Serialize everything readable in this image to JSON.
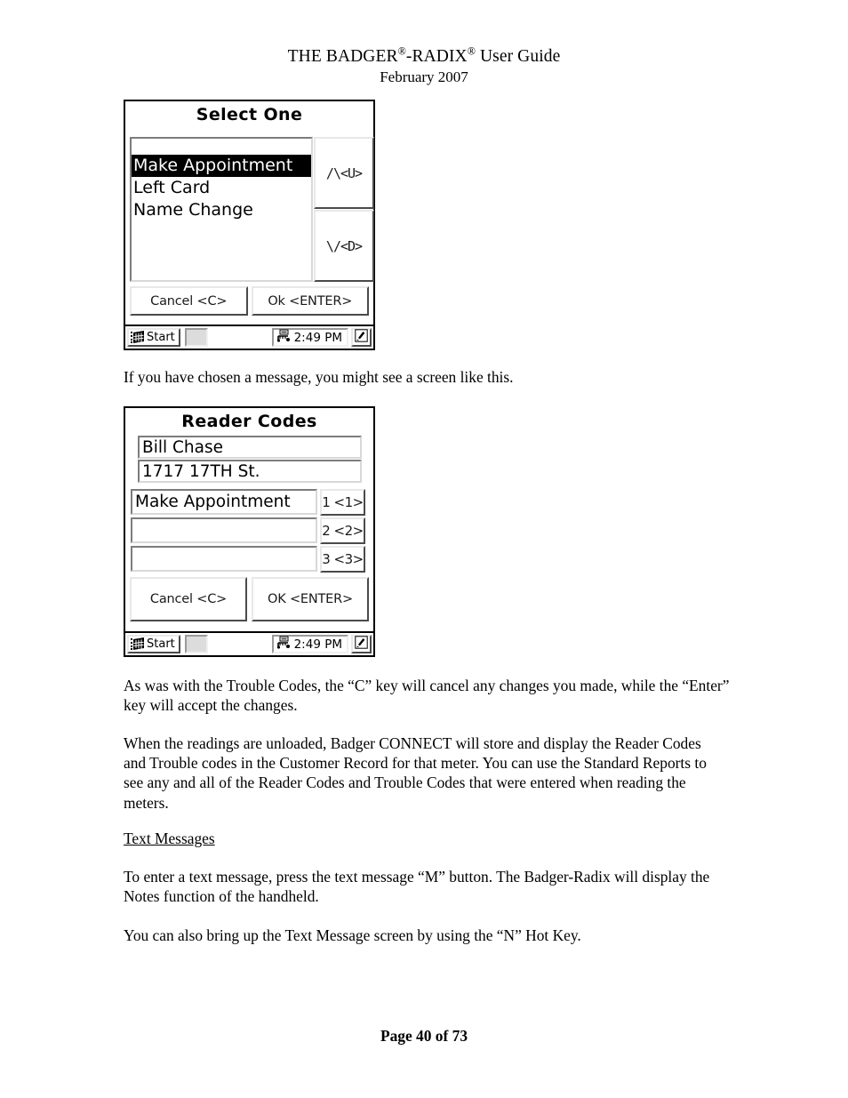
{
  "header": {
    "title_prefix": "THE BADGER",
    "reg_mark": "®",
    "title_mid": "-RADIX",
    "title_suffix": " User Guide",
    "date": "February 2007"
  },
  "select_one_dialog": {
    "title": "Select One",
    "list": {
      "items": [
        {
          "label": "Make Appointment",
          "selected": true
        },
        {
          "label": "Left Card",
          "selected": false
        },
        {
          "label": "Name Change",
          "selected": false
        }
      ]
    },
    "buttons": {
      "up": "/\\<U>",
      "down": "\\/<D>",
      "cancel": "Cancel <C>",
      "ok": "Ok <ENTER>"
    },
    "taskbar": {
      "start_label": "Start",
      "time": "2:49 PM"
    }
  },
  "caption_after_first": "If you have chosen a message, you might see a screen like this.",
  "reader_codes_dialog": {
    "title": "Reader Codes",
    "fields": {
      "customer_name": "Bill Chase",
      "customer_address": "1717 17TH St.",
      "code_1": "Make Appointment",
      "code_2": "",
      "code_3": ""
    },
    "buttons": {
      "num1": "1 <1>",
      "num2": "2 <2>",
      "num3": "3 <3>",
      "cancel": "Cancel <C>",
      "ok": "OK <ENTER>"
    },
    "taskbar": {
      "start_label": "Start",
      "time": "2:49 PM"
    }
  },
  "body": {
    "para_trouble_codes": "As was with the Trouble Codes, the “C” key will cancel any changes you made, while the “Enter” key will accept the changes.",
    "para_unloaded": "When the readings are unloaded, Badger CONNECT will store and display the Reader Codes and Trouble codes in the Customer Record for that meter.   You can use the Standard Reports to see any and all of the Reader Codes and Trouble Codes that were entered when reading the meters.",
    "section_text_messages": "Text Messages",
    "para_text_message": "To enter a text message, press the text message “M” button.  The Badger-Radix will display the Notes function of the handheld.",
    "para_hot_key": "You can also bring up the Text Message screen by using the “N” Hot Key."
  },
  "footer": {
    "page_label": "Page 40 of 73"
  }
}
